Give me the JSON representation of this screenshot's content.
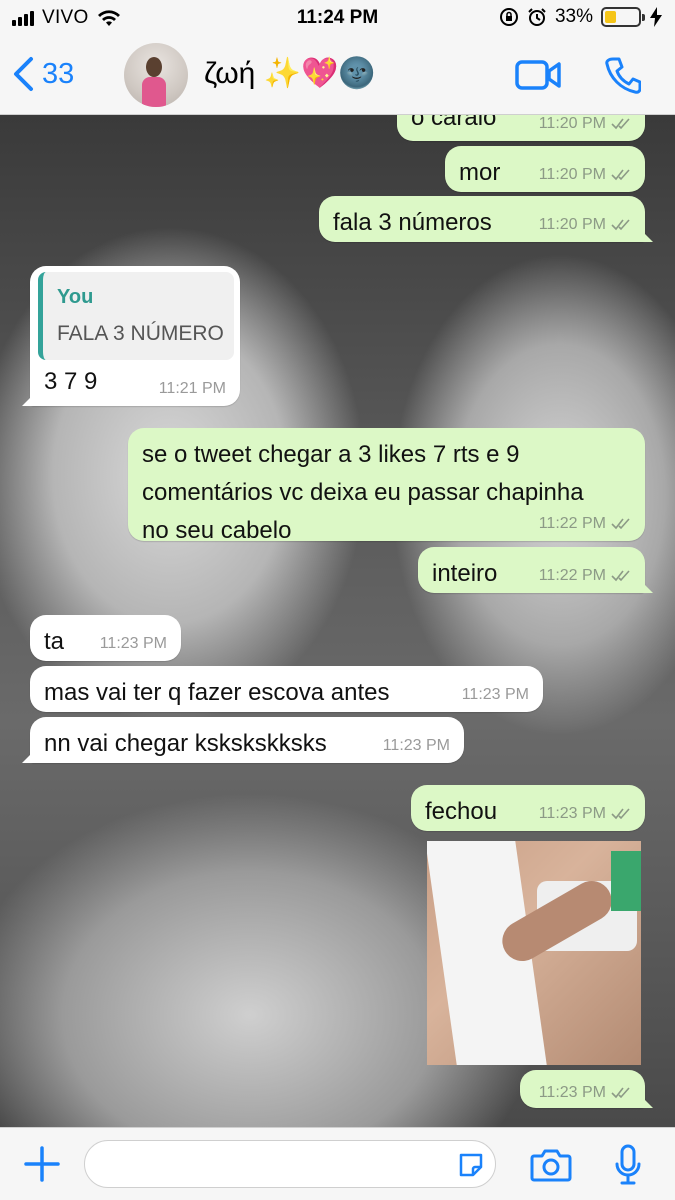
{
  "status_bar": {
    "carrier": "VIVO",
    "time": "11:24 PM",
    "battery": "33%",
    "battery_level": 0.33
  },
  "header": {
    "back_count": "33",
    "contact_name": "ζωή ✨💖🌚"
  },
  "messages": [
    {
      "dir": "out",
      "text": "o caralo",
      "time": "11:20 PM"
    },
    {
      "dir": "out",
      "text": "mor",
      "time": "11:20 PM"
    },
    {
      "dir": "out",
      "text": "fala 3 números",
      "time": "11:20 PM"
    },
    {
      "dir": "in",
      "quote_author": "You",
      "quote_text": "FALA 3 NÚMERO",
      "text": "3 7 9",
      "time": "11:21 PM"
    },
    {
      "dir": "out",
      "lines": [
        "se o tweet chegar a 3 likes 7 rts e 9",
        "comentários vc deixa eu passar chapinha",
        "no seu cabelo"
      ],
      "time": "11:22 PM"
    },
    {
      "dir": "out",
      "text": "inteiro",
      "time": "11:22 PM"
    },
    {
      "dir": "in",
      "text": "ta",
      "time": "11:23 PM"
    },
    {
      "dir": "in",
      "text": "mas vai ter q fazer escova antes",
      "time": "11:23 PM"
    },
    {
      "dir": "in",
      "text": "nn vai chegar kskskskksks",
      "time": "11:23 PM"
    },
    {
      "dir": "out",
      "text": "fechou",
      "time": "11:23 PM"
    },
    {
      "dir": "out",
      "media": "photo",
      "time": "11:23 PM"
    }
  ],
  "composer": {
    "placeholder": ""
  },
  "colors": {
    "accent": "#1a82fb",
    "outgoing_bubble": "#dcf8c6",
    "incoming_bubble": "#ffffff",
    "quote_bar": "#34a39a"
  },
  "icons": [
    "back-chevron-icon",
    "video-call-icon",
    "phone-icon",
    "plus-icon",
    "sticker-icon",
    "camera-icon",
    "mic-icon"
  ]
}
